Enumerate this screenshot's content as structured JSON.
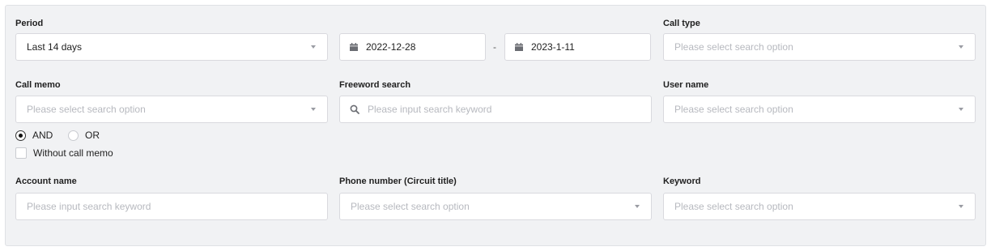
{
  "period": {
    "label": "Period",
    "value": "Last 14 days"
  },
  "date_range": {
    "start": "2022-12-28",
    "separator": "-",
    "end": "2023-1-11"
  },
  "call_type": {
    "label": "Call type",
    "placeholder": "Please select search option"
  },
  "call_memo": {
    "label": "Call memo",
    "placeholder": "Please select search option",
    "logic": {
      "and_label": "AND",
      "or_label": "OR",
      "selected": "AND"
    },
    "without_label": "Without call memo"
  },
  "freeword": {
    "label": "Freeword search",
    "placeholder": "Please input search keyword"
  },
  "user_name": {
    "label": "User name",
    "placeholder": "Please select search option"
  },
  "account_name": {
    "label": "Account name",
    "placeholder": "Please input search keyword"
  },
  "phone_number": {
    "label": "Phone number (Circuit title)",
    "placeholder": "Please select search option"
  },
  "keyword": {
    "label": "Keyword",
    "placeholder": "Please select search option"
  },
  "icons": {
    "date": "calendar-icon",
    "search": "search-icon",
    "dropdown": "chevron-down-icon"
  }
}
